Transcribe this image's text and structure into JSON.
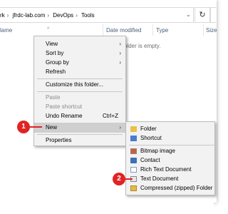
{
  "address_bar": {
    "crumbs": [
      "rk",
      "jfrdc-lab.com",
      "DevOps",
      "Tools"
    ],
    "dropdown_icon": "chevron-down-icon",
    "refresh_icon": "refresh-icon",
    "search_icon": "search-icon"
  },
  "columns": {
    "name": "lame",
    "date_modified": "Date modified",
    "type": "Type",
    "size": "Size"
  },
  "empty_message": "older is empty.",
  "context_menu": {
    "view": "View",
    "sort_by": "Sort by",
    "group_by": "Group by",
    "refresh": "Refresh",
    "customize": "Customize this folder...",
    "paste": "Paste",
    "paste_shortcut": "Paste shortcut",
    "undo_rename": "Undo Rename",
    "undo_shortcut": "Ctrl+Z",
    "new": "New",
    "properties": "Properties"
  },
  "new_submenu": {
    "folder": "Folder",
    "shortcut": "Shortcut",
    "bitmap": "Bitmap image",
    "contact": "Contact",
    "rtf": "Rich Text Document",
    "text": "Text Document",
    "zip": "Compressed (zipped) Folder"
  },
  "annotations": {
    "step1": "1",
    "step2": "2",
    "color": "#e02424"
  }
}
